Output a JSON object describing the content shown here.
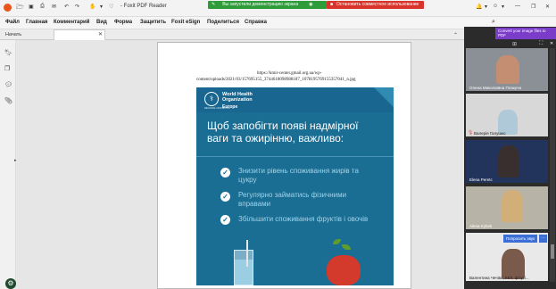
{
  "app": {
    "title": "- Foxit PDF Reader",
    "share_status": "Вы запустили демонстрацию экрана",
    "stop_share": "Остановить совместное использование"
  },
  "menu": [
    "Файл",
    "Главная",
    "Комментарий",
    "Вид",
    "Форма",
    "Защитить",
    "Foxit eSign",
    "Поделиться",
    "Справка"
  ],
  "tab": {
    "label": "Начать"
  },
  "document": {
    "url_line1": "https://kmir-center.gmail.org.ua/wp-",
    "url_line2": "content/uploads/2021/03/157695155_3744618098988187_1078195769155357041_n.jpg",
    "poster": {
      "org_name": "World Health Organization",
      "org_region": "Europe",
      "org_sub": "REGIONAL OFFICE FOR",
      "heading": "Щоб запобігти появі надмірної ваги та ожирінню, важливо:",
      "items": [
        "Знизити рівень споживання жирів та цукру",
        "Регулярно займатись фізичними вправами",
        "Збільшити споживання фруктів і овочів"
      ]
    }
  },
  "video": {
    "convert_banner": "Convert your image files to PDF",
    "participants": [
      {
        "name": "Олена Миколаївна Плакуча"
      },
      {
        "name": "Валерія Галушко"
      },
      {
        "name": "Elena Peretc"
      },
      {
        "name": "Alena Kybek"
      },
      {
        "name": "Валентина Чечіва, ККЛ, фітусі..."
      }
    ],
    "ask_button": "Попросить звук"
  },
  "colors": {
    "poster_bg": "#1a6d93",
    "poster_text": "#ffffff",
    "poster_item_text": "#9fd4ea",
    "share_green": "#2e9c3a",
    "stop_red": "#d9342b",
    "convert_purple": "#7b3cc9"
  }
}
